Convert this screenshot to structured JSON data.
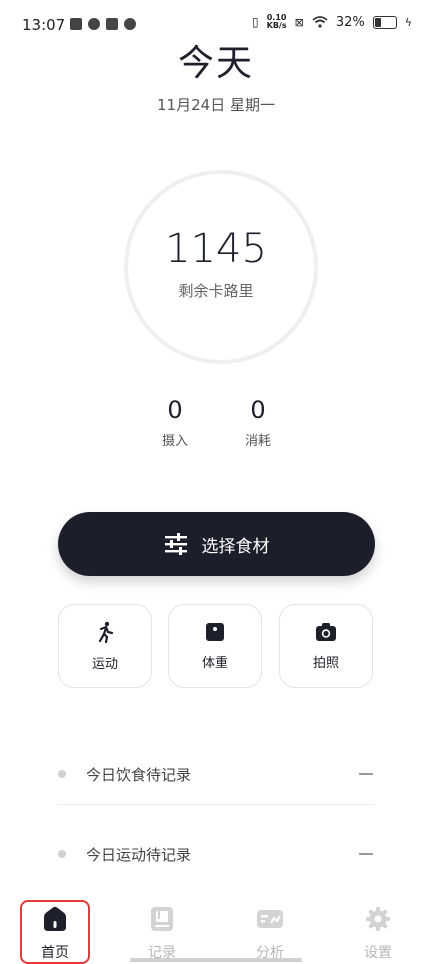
{
  "status_bar": {
    "time": "13:07",
    "speed_top": "0.10",
    "speed_bottom": "KB/s",
    "battery_text": "32%",
    "battery_level": 0.32
  },
  "header": {
    "title": "今天",
    "date": "11月24日 星期一"
  },
  "calories": {
    "value": "1145",
    "label": "剩余卡路里"
  },
  "stats": {
    "intake": {
      "value": "0",
      "label": "摄入"
    },
    "burn": {
      "value": "0",
      "label": "消耗"
    }
  },
  "primary_action": {
    "label": "选择食材",
    "icon": "sliders-icon"
  },
  "actions": [
    {
      "label": "运动",
      "icon": "running-icon"
    },
    {
      "label": "体重",
      "icon": "scale-icon"
    },
    {
      "label": "拍照",
      "icon": "camera-icon"
    }
  ],
  "records": [
    {
      "label": "今日饮食待记录"
    },
    {
      "label": "今日运动待记录"
    }
  ],
  "nav": [
    {
      "label": "首页",
      "icon": "home-icon",
      "active": true
    },
    {
      "label": "记录",
      "icon": "book-icon",
      "active": false
    },
    {
      "label": "分析",
      "icon": "analysis-icon",
      "active": false
    },
    {
      "label": "设置",
      "icon": "gear-icon",
      "active": false
    }
  ],
  "colors": {
    "primary": "#1c1e2b",
    "inactive": "#b7b7b7",
    "highlight": "#e53a3a"
  }
}
